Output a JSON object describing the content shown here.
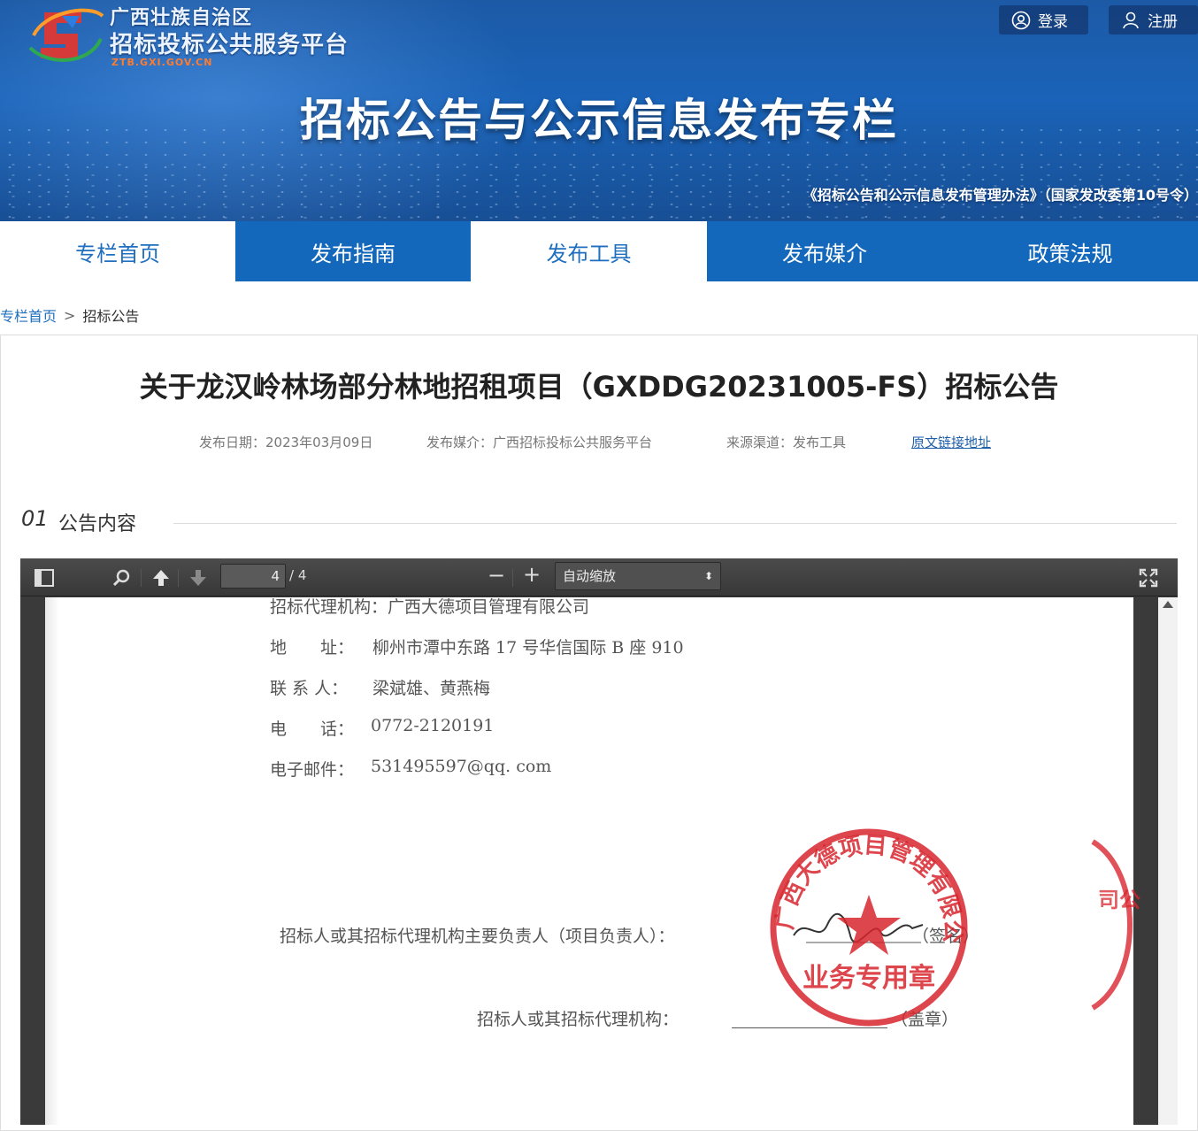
{
  "header": {
    "logo_line1": "广西壮族自治区",
    "logo_line2": "招标投标公共服务平台",
    "logo_url": "ZTB.GXI.GOV.CN",
    "login_label": "登录",
    "register_label": "注册",
    "banner_title": "招标公告与公示信息发布专栏",
    "banner_subtitle": "《招标公告和公示信息发布管理办法》（国家发改委第10号令）"
  },
  "nav": {
    "items": [
      {
        "label": "专栏首页"
      },
      {
        "label": "发布指南"
      },
      {
        "label": "发布工具"
      },
      {
        "label": "发布媒介"
      },
      {
        "label": "政策法规"
      }
    ]
  },
  "breadcrumb": {
    "home": "专栏首页",
    "separator": ">",
    "current": "招标公告"
  },
  "article": {
    "title": "关于龙汉岭林场部分林地招租项目（GXDDG20231005-FS）招标公告",
    "publish_date": "发布日期：2023年03月09日",
    "media": "发布媒介：广西招标投标公共服务平台",
    "source": "来源渠道：发布工具",
    "original_link": "原文链接地址"
  },
  "section": {
    "number": "01",
    "title": "公告内容"
  },
  "viewer": {
    "page_current": "4",
    "page_total": "/ 4",
    "zoom_label": "自动缩放",
    "zoom_out": "−",
    "zoom_in": "+"
  },
  "pdf": {
    "agency": "招标代理机构：广西大德项目管理有限公司",
    "address_label": "地　　址：",
    "address_value": "柳州市潭中东路 17 号华信国际 B 座 910",
    "contact_label": "联 系 人：",
    "contact_value": "梁斌雄、黄燕梅",
    "phone_label": "电　　话：",
    "phone_value": "0772-2120191",
    "email_label": "电子邮件：",
    "email_value": "531495597@qq. com",
    "sign_line": "招标人或其招标代理机构主要负责人（项目负责人）：",
    "sign_suffix": "（签名）",
    "seal_line": "招标人或其招标代理机构：",
    "seal_suffix": "（盖章）",
    "seal_text_outer": "广西大德项目管理有限公司",
    "seal_text_inner": "业务专用章",
    "seal2_text": "司公"
  },
  "colors": {
    "nav_dark": "#1468bb",
    "nav_light_text": "#1f6fbf",
    "seal_red": "#d8262f"
  }
}
